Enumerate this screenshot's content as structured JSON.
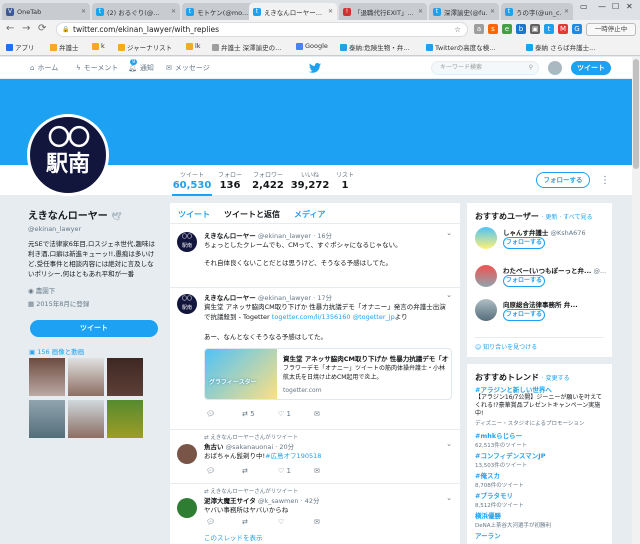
{
  "browser": {
    "tabs": [
      {
        "label": "OneTab",
        "icon": "onetab-icon",
        "color": "#3b5998"
      },
      {
        "label": "(2) おるぐり(@...",
        "icon": "twitter-icon",
        "color": "#1da1f2"
      },
      {
        "label": "モトケン(@mo...",
        "icon": "twitter-icon",
        "color": "#1da1f2"
      },
      {
        "label": "えきなんローヤー...",
        "icon": "twitter-icon",
        "color": "#1da1f2",
        "active": true
      },
      {
        "label": "「退職代行EXIT」...",
        "icon": "news-icon",
        "color": "#d32f2f"
      },
      {
        "label": "深澤諭史(@fu...",
        "icon": "twitter-icon",
        "color": "#1da1f2"
      },
      {
        "label": "うの字(@un_c...",
        "icon": "twitter-icon",
        "color": "#1da1f2"
      }
    ],
    "url": "twitter.com/ekinan_lawyer/with_replies",
    "pause_label": "一時停止中",
    "bookmarks": [
      "アプリ",
      "弁護士",
      "k",
      "ジャーナリスト",
      "lk",
      "弁護士 深澤諭史の...",
      "Google",
      "泰納:危険生物・弁...",
      "Twitterの高度な検...",
      "泰納 さらば弁護士..."
    ]
  },
  "nav": {
    "home": "ホーム",
    "moments": "モーメント",
    "notifications": "通知",
    "notif_count": "9",
    "messages": "メッセージ",
    "search_placeholder": "キーワード検索",
    "tweet_button": "ツイート"
  },
  "profile": {
    "avatar_top": "〇〇",
    "avatar_bottom": "駅南",
    "name": "えきなんローヤー",
    "handle": "@ekinan_lawyer",
    "bio": "元SEで法律家6年目,ロスジェネ世代,趣味は利き酒,口癖は新進キューッ!!,愚痴は多いけど,受任事件と相談内容には絶対に言及しないポリシー,何はともあれ平和が一番",
    "location": "農園下",
    "joined": "2015年8月に登録",
    "tweet_button": "ツイート",
    "media_label": "156 画像と動画",
    "follow_button": "フォローする",
    "stats": [
      {
        "label": "ツイート",
        "value": "60,530"
      },
      {
        "label": "フォロー",
        "value": "136"
      },
      {
        "label": "フォロワー",
        "value": "2,422"
      },
      {
        "label": "いいね",
        "value": "39,272"
      },
      {
        "label": "リスト",
        "value": "1"
      }
    ]
  },
  "timeline": {
    "tabs": [
      "ツイート",
      "ツイートと返信",
      "メディア"
    ],
    "tweets": [
      {
        "name": "えきなんローヤー",
        "meta": "@ekinan_lawyer · 16分",
        "text1": "ちょっとしたクレームでも、CMって、すぐポシャになるじゃない。",
        "text2": "それ自体良くないことだとは思うけど、そうなる予感はしてた。"
      },
      {
        "name": "えきなんローヤー",
        "meta": "@ekinan_lawyer · 17分",
        "text1": "資生堂 アネッサ脇肉CM取り下げか 性暴力抗議デモ「オナニー」発言の弁護士出演で抗議殺到 - Togetter",
        "link1": "togetter.com/li/1356160",
        "link2": "@togetter_jp",
        "text1_tail": "より",
        "text2": "あー、なんとなくそうなる予感はしてた。",
        "card_title": "資生堂 アネッサ脇肉CM取り下げか 性暴力抗議デモ「オナ...",
        "card_desc": "フラワーデモ「オナニー」ツイートの筋肉体操弁護士・小林航太氏を日焼け止めCM起用で炎上。",
        "card_domain": "togetter.com",
        "card_image_text": "グラフィースター",
        "retweets": "5",
        "likes": "1"
      },
      {
        "retweeted_by": "えきなんローヤーさんがリツイート",
        "name": "魚古い",
        "meta": "@sakanauonai · 20分",
        "text1": "おばちゃん髭剃り中!",
        "hashtag": "#広島オフ190518",
        "likes": "1"
      },
      {
        "retweeted_by": "えきなんローヤーさんがリツイート",
        "name": "泥濘大魔王サイタ",
        "meta": "@k_sawmen · 42分",
        "text1": "ヤバい事務所はヤバいからね",
        "thread_link": "このスレッドを表示"
      }
    ]
  },
  "recommendations": {
    "title": "おすすめユーザー",
    "links": "· 更新 · すべて見る",
    "users": [
      {
        "name": "しゃんす弁護士",
        "handle": "@KshA676"
      },
      {
        "name": "わたベー(いつもぽーっと弁...",
        "handle": "@..."
      },
      {
        "name": "向原総合法律事務所 弁...",
        "handle": ""
      }
    ],
    "follow_label": "フォローする",
    "find_friends": "知り合いを見つける"
  },
  "trends": {
    "title": "おすすめトレンド",
    "change": "· 変更する",
    "items": [
      {
        "topic": "#アラジンと新しい世界へ",
        "count": "【アラジン16/7公開】ジーニーが願いを叶えてくれる!?豪華賞品プレゼントキャンペーン実施中!",
        "promoted": "ディズニー・スタジオによるプロモーション"
      },
      {
        "topic": "#mhkらじらー",
        "count": "62,513件のツイート"
      },
      {
        "topic": "#コンフィデンスマンJP",
        "count": "13,503件のツイート"
      },
      {
        "topic": "#俺スカ",
        "count": "8,708件のツイート"
      },
      {
        "topic": "#ブラタモリ",
        "count": "8,512件のツイート"
      },
      {
        "topic": "横浜優勝",
        "count": "DeNA上茶谷大河選手が初勝利"
      },
      {
        "topic": "アーラン",
        "count": ""
      }
    ]
  },
  "colors": {
    "twitter_blue": "#1da1f2",
    "avatar_navy": "#12153c"
  }
}
